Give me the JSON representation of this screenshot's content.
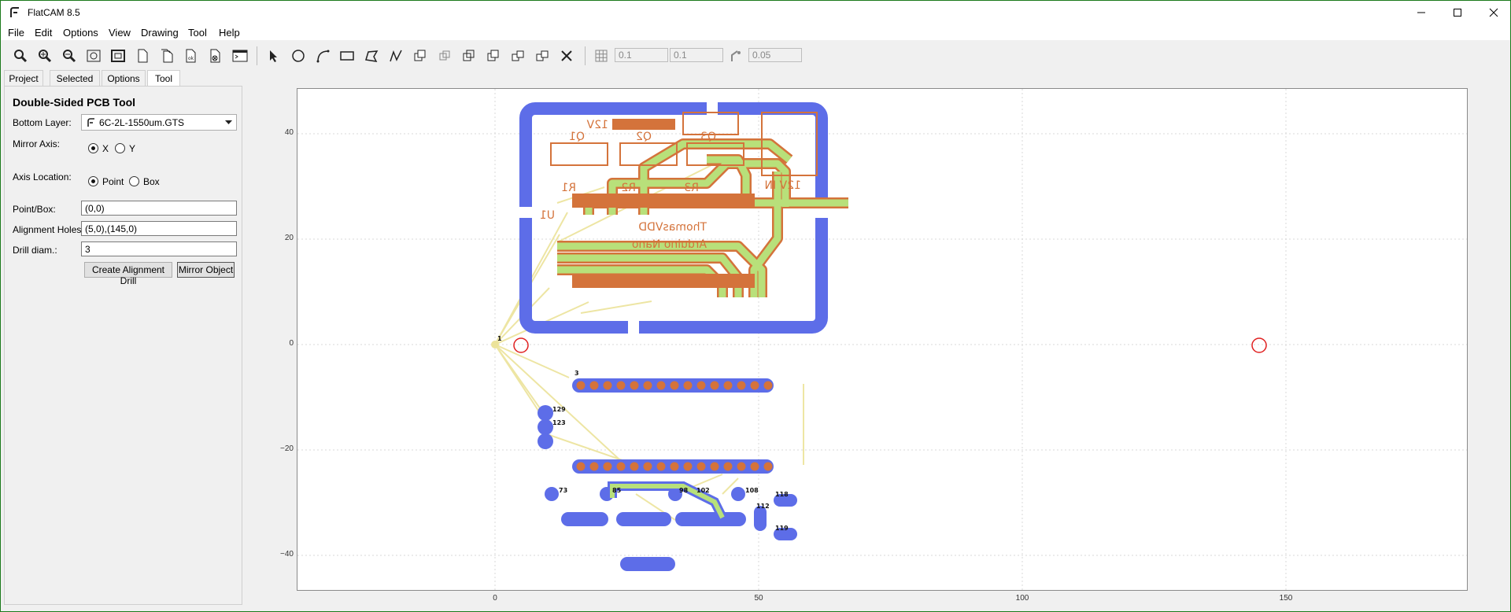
{
  "window": {
    "title": "FlatCAM 8.5"
  },
  "menu": [
    "File",
    "Edit",
    "Options",
    "View",
    "Drawing",
    "Tool",
    "Help"
  ],
  "toolbar": {
    "grid_x": "0.1",
    "grid_y": "0.1",
    "snap_max": "0.05",
    "icons": [
      "zoom-fit-icon",
      "zoom-in-icon",
      "zoom-out-icon",
      "replot-icon",
      "clear-plot-icon",
      "new-geometry-icon",
      "new-excellon-icon",
      "ok-icon",
      "delete-icon",
      "shell-icon",
      "select-icon",
      "circle-icon",
      "arc-icon",
      "rectangle-icon",
      "polygon-icon",
      "path-icon",
      "union-icon",
      "intersection-icon",
      "subtraction-icon",
      "cut-path-icon",
      "copy-icon",
      "move-icon",
      "delete-shape-icon",
      "grid-snap-icon",
      "corner-snap-icon"
    ]
  },
  "tabs": [
    "Project",
    "Selected",
    "Options",
    "Tool"
  ],
  "active_tab": "Tool",
  "tool": {
    "heading": "Double-Sided PCB Tool",
    "bottom_layer_label": "Bottom Layer:",
    "bottom_layer_value": "6C-2L-1550um.GTS",
    "mirror_axis_label": "Mirror Axis:",
    "mirror_x": "X",
    "mirror_y": "Y",
    "axis_location_label": "Axis Location:",
    "axis_point": "Point",
    "axis_box": "Box",
    "point_box_label": "Point/Box:",
    "point_box_value": "(0,0)",
    "alignment_holes_label": "Alignment Holes:",
    "alignment_holes_value": "(5,0),(145,0)",
    "drill_diam_label": "Drill diam.:",
    "drill_diam_value": "3",
    "create_button": "Create Alignment Drill",
    "mirror_button": "Mirror Object"
  },
  "plot": {
    "x_ticks": [
      "0",
      "50",
      "100",
      "150"
    ],
    "y_ticks": [
      "40",
      "20",
      "0",
      "−20",
      "−40"
    ],
    "board_labels": {
      "r1": "R1",
      "r2": "R2",
      "r3": "R3",
      "u1": "U1",
      "brand": "ThomasVDD",
      "part": "Arduino Nano",
      "in12": "12V IN",
      "v12": "12V",
      "q1": "Q1",
      "q2": "Q2",
      "q3": "Q3"
    },
    "drill_numbers": [
      "1",
      "3",
      "129",
      "123",
      "73",
      "85",
      "98",
      "102",
      "108",
      "112",
      "118",
      "119"
    ]
  },
  "colors": {
    "copper_fill": "#b8e07a",
    "trace_outline": "#d4733b",
    "mask_blue": "#5d6de8",
    "alignment_hole": "#e02020",
    "rats_nest": "#e8df8a"
  }
}
